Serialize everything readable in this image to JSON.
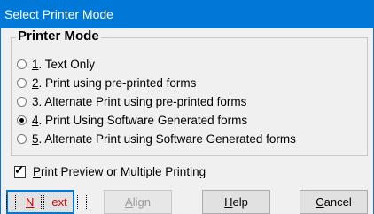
{
  "window": {
    "title": "Select Printer Mode"
  },
  "group": {
    "title": "Printer Mode"
  },
  "options": [
    {
      "num": "1",
      "rest": ". Text Only",
      "checked": false
    },
    {
      "num": "2",
      "rest": ". Print using pre-printed forms",
      "checked": false
    },
    {
      "num": "3",
      "rest": ". Alternate Print using pre-printed forms",
      "checked": false
    },
    {
      "num": "4",
      "rest": ". Print Using Software Generated forms",
      "checked": true
    },
    {
      "num": "5",
      "rest": ". Alternate Print using Software Generated forms",
      "checked": false
    }
  ],
  "preview": {
    "label_underline": "P",
    "label_rest": "rint Preview or Multiple Printing",
    "checked": true
  },
  "buttons": {
    "next": {
      "u": "N",
      "rest": "ext"
    },
    "align": {
      "u": "A",
      "rest": "lign"
    },
    "help": {
      "u": "H",
      "rest": "elp"
    },
    "cancel": {
      "u": "C",
      "rest": "ancel"
    }
  }
}
